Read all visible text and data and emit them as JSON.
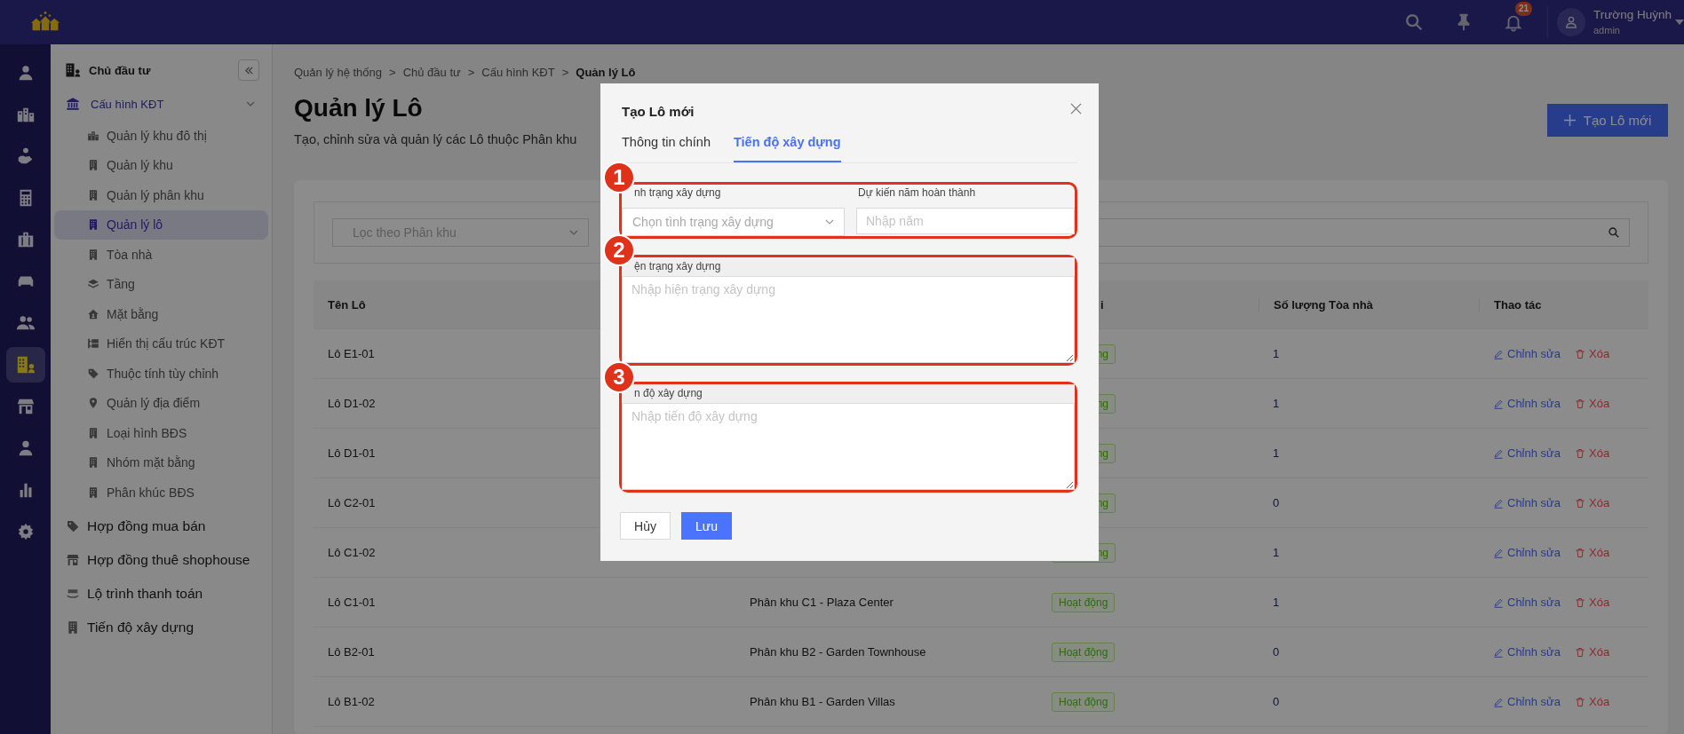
{
  "topbar": {
    "notifications": "21",
    "user": {
      "name": "Trường Huỳnh",
      "role": "admin"
    }
  },
  "rail": [
    {
      "selected": false
    },
    {
      "selected": false
    },
    {
      "selected": false
    },
    {
      "selected": false
    },
    {
      "selected": false
    },
    {
      "selected": false
    },
    {
      "selected": false
    },
    {
      "selected": true
    },
    {
      "selected": false
    },
    {
      "selected": false
    },
    {
      "selected": false
    },
    {
      "selected": false
    }
  ],
  "sidebar": {
    "header": "Chủ đầu tư",
    "items": [
      {
        "label": "Cấu hình KĐT",
        "expanded": true,
        "selected": false,
        "children": [
          {
            "label": "Quản lý khu đô thị",
            "selected": false
          },
          {
            "label": "Quản lý khu",
            "selected": false
          },
          {
            "label": "Quản lý phân khu",
            "selected": false
          },
          {
            "label": "Quản lý lô",
            "selected": true
          },
          {
            "label": "Tòa nhà",
            "selected": false
          },
          {
            "label": "Tầng",
            "selected": false
          },
          {
            "label": "Mặt bằng",
            "selected": false
          },
          {
            "label": "Hiển thị cấu trúc KĐT",
            "selected": false
          },
          {
            "label": "Thuộc tính tùy chỉnh",
            "selected": false
          },
          {
            "label": "Quản lý địa điểm",
            "selected": false
          },
          {
            "label": "Loại hình BĐS",
            "selected": false
          },
          {
            "label": "Nhóm mặt bằng",
            "selected": false
          },
          {
            "label": "Phân khúc BĐS",
            "selected": false
          }
        ]
      },
      {
        "label": "Hợp đồng mua bán",
        "selected": false
      },
      {
        "label": "Hợp đồng thuê shophouse",
        "selected": false
      },
      {
        "label": "Lộ trình thanh toán",
        "selected": false
      },
      {
        "label": "Tiến độ xây dựng",
        "selected": false
      }
    ]
  },
  "breadcrumb": {
    "separator": ">",
    "items": [
      {
        "label": "Quản lý hệ thống",
        "current": false
      },
      {
        "label": "Chủ đầu tư",
        "current": false
      },
      {
        "label": "Cấu hình KĐT",
        "current": false
      },
      {
        "label": "Quản lý Lô",
        "current": true
      }
    ]
  },
  "page": {
    "title": "Quản lý Lô",
    "subtitle": "Tạo, chỉnh sửa và quản lý các Lô thuộc Phân khu",
    "create_button": "Tạo Lô mới"
  },
  "filter": {
    "placeholder": "Lọc theo Phân khu"
  },
  "table": {
    "columns": [
      {
        "label": "Tên Lô"
      },
      {},
      {
        "label": "i"
      },
      {
        "label": "Số lượng Tòa nhà"
      },
      {
        "label": "Thao tác"
      }
    ],
    "rows": [
      {
        "name": "Lô E1-01",
        "status": "ng",
        "count": "1",
        "edit": "Chỉnh sửa",
        "delete": "Xóa"
      },
      {
        "name": "Lô D1-02",
        "status": "ng",
        "count": "1",
        "edit": "Chỉnh sửa",
        "delete": "Xóa"
      },
      {
        "name": "Lô D1-01",
        "status": "ng",
        "count": "1",
        "edit": "Chỉnh sửa",
        "delete": "Xóa"
      },
      {
        "name": "Lô C2-01",
        "status": "ng",
        "count": "0",
        "edit": "Chỉnh sửa",
        "delete": "Xóa"
      },
      {
        "name": "Lô C1-02",
        "status": "ng",
        "count": "1",
        "edit": "Chỉnh sửa",
        "delete": "Xóa"
      },
      {
        "name": "Lô C1-01",
        "zone": "Phân khu C1 - Plaza Center",
        "status": "Hoạt động",
        "count": "1",
        "edit": "Chỉnh sửa",
        "delete": "Xóa"
      },
      {
        "name": "Lô B2-01",
        "zone": "Phân khu B2 - Garden Townhouse",
        "status": "Hoạt động",
        "count": "0",
        "edit": "Chỉnh sửa",
        "delete": "Xóa"
      },
      {
        "name": "Lô B1-02",
        "zone": "Phân khu B1 - Garden Villas",
        "status": "Hoạt động",
        "count": "0",
        "edit": "Chỉnh sửa",
        "delete": "Xóa"
      }
    ]
  },
  "modal": {
    "title": "Tạo Lô mới",
    "tabs": [
      {
        "label": "Thông tin chính",
        "selected": false
      },
      {
        "label": "Tiến độ xây dựng",
        "selected": true
      }
    ],
    "sections": [
      {
        "marker": "1",
        "fields": [
          {
            "kind": "select",
            "label": "nh trạng xây dựng",
            "placeholder": "Chọn tình trạng xây dựng"
          },
          {
            "kind": "input",
            "label": "Dự kiến năm hoàn thành",
            "placeholder": "Nhập năm"
          }
        ]
      },
      {
        "marker": "2",
        "fields": [
          {
            "kind": "textarea",
            "label": "ện trạng xây dựng",
            "placeholder": "Nhập hiện trạng xây dựng"
          }
        ]
      },
      {
        "marker": "3",
        "fields": [
          {
            "kind": "textarea",
            "label": "n độ xây dựng",
            "placeholder": "Nhập tiến độ xây dựng"
          }
        ]
      }
    ],
    "buttons": [
      {
        "label": "Hủy",
        "kind": "secondary"
      },
      {
        "label": "Lưu",
        "kind": "primary"
      }
    ]
  }
}
